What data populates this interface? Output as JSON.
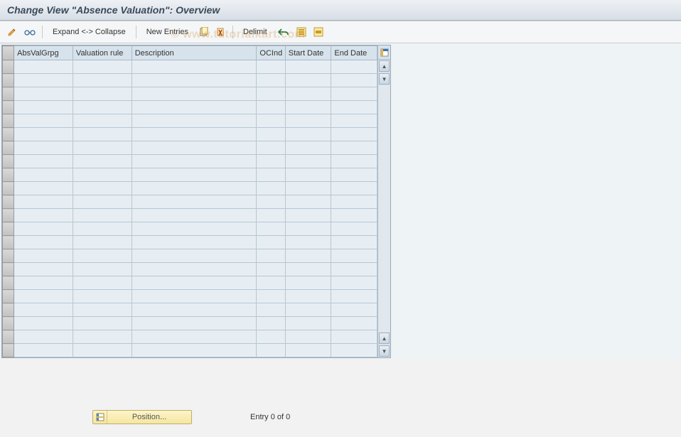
{
  "title": "Change View \"Absence Valuation\": Overview",
  "toolbar": {
    "expand_collapse_label": "Expand <-> Collapse",
    "new_entries_label": "New Entries",
    "delimit_label": "Delimit",
    "icons": {
      "edit": "edit-pencil",
      "glasses": "display-glasses",
      "copy": "copy-icon",
      "delete": "delete-icon",
      "undo": "undo-icon",
      "select_all": "select-all-icon",
      "select_block": "select-block-icon"
    }
  },
  "table": {
    "columns": [
      {
        "key": "absvalgrpg",
        "label": "AbsValGrpg"
      },
      {
        "key": "valrule",
        "label": "Valuation rule"
      },
      {
        "key": "desc",
        "label": "Description"
      },
      {
        "key": "ocind",
        "label": "OCInd"
      },
      {
        "key": "startdate",
        "label": "Start Date"
      },
      {
        "key": "enddate",
        "label": "End Date"
      }
    ],
    "rows": [
      {},
      {},
      {},
      {},
      {},
      {},
      {},
      {},
      {},
      {},
      {},
      {},
      {},
      {},
      {},
      {},
      {},
      {},
      {},
      {},
      {},
      {}
    ],
    "corner_icon": "table-settings-icon"
  },
  "footer": {
    "position_button_label": "Position...",
    "entry_status": "Entry 0 of 0"
  },
  "watermark": "© www.tutorialkart.com"
}
